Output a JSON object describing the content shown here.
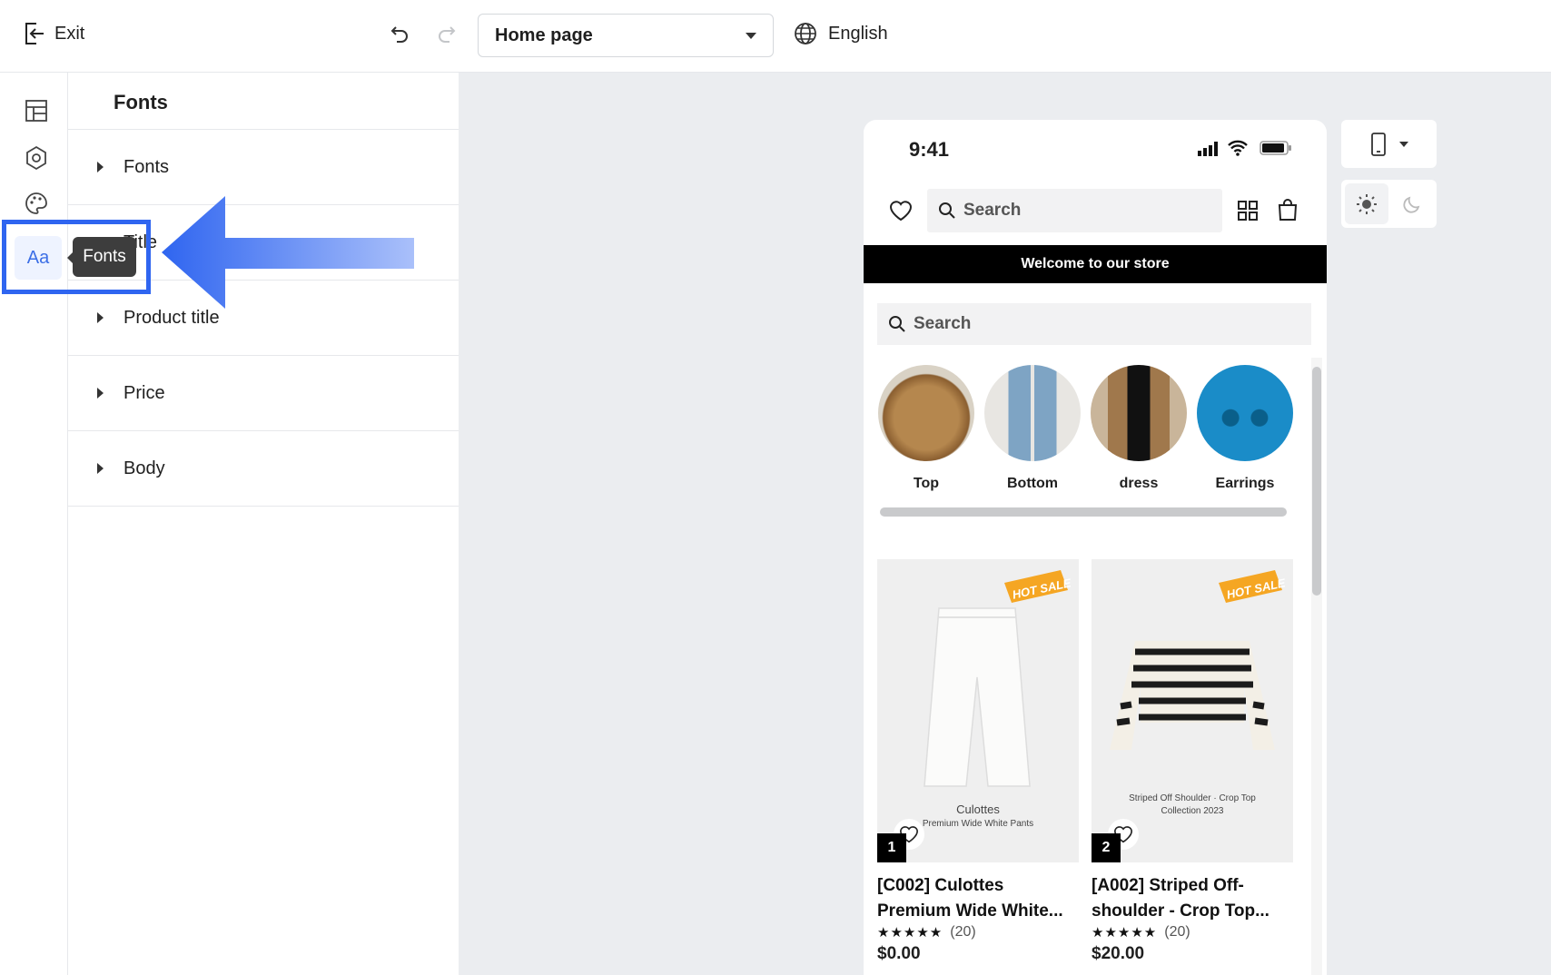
{
  "topbar": {
    "exit_label": "Exit",
    "page_select": "Home page",
    "language": "English"
  },
  "rail": {
    "active": "fonts-text-icon",
    "aa_label": "Aa"
  },
  "panel": {
    "title": "Fonts",
    "rows": [
      {
        "label": "Fonts"
      },
      {
        "label": "Title"
      },
      {
        "label": "Product title"
      },
      {
        "label": "Price"
      },
      {
        "label": "Body"
      }
    ]
  },
  "tooltip": {
    "label": "Fonts"
  },
  "phone": {
    "time": "9:41",
    "nav_search_placeholder": "Search",
    "banner": "Welcome to our store",
    "search_placeholder": "Search",
    "categories": [
      {
        "label": "Top"
      },
      {
        "label": "Bottom"
      },
      {
        "label": "dress"
      },
      {
        "label": "Earrings"
      }
    ],
    "products": [
      {
        "rank": "1",
        "title_line1": "[C002] Culottes",
        "title_line2": "Premium Wide White...",
        "rating_count": "(20)",
        "price": "$0.00",
        "caption1": "Culottes",
        "caption2": "Premium Wide White Pants",
        "hot": "HOT SALE"
      },
      {
        "rank": "2",
        "title_line1": "[A002] Striped Off-",
        "title_line2": "shoulder - Crop Top...",
        "rating_count": "(20)",
        "price": "$20.00",
        "caption1": "Striped Off Shoulder · Crop Top",
        "caption2": "Collection 2023",
        "hot": "HOT SALE"
      }
    ],
    "stars": "★★★★★"
  },
  "colors": {
    "accent": "#2f65f0",
    "canvas_bg": "#ebedf0",
    "banner_bg": "#000000"
  }
}
